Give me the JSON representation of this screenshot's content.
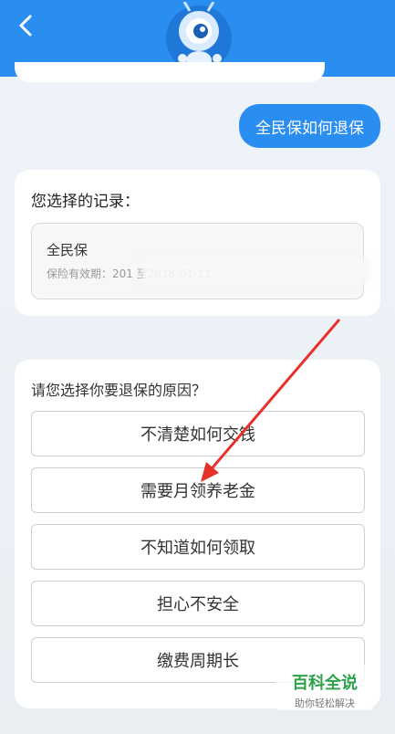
{
  "header": {
    "back_icon": "chevron-left-icon",
    "mascot": "ant-mascot-avatar"
  },
  "chat": {
    "user_message": "全民保如何退保"
  },
  "record_card": {
    "title": "您选择的记录：",
    "record_name": "全民保",
    "validity_text": "保险有效期：201      至2018-01-11"
  },
  "reason_card": {
    "prompt": "请您选择你要退保的原因？",
    "options": [
      "不清楚如何交钱",
      "需要月领养老金",
      "不知道如何领取",
      "担心不安全",
      "缴费周期长"
    ]
  },
  "watermark": {
    "main": "百科全说",
    "sub": "助你轻松解决"
  },
  "colors": {
    "primary": "#2a8ef0",
    "arrow": "#e8302a"
  }
}
